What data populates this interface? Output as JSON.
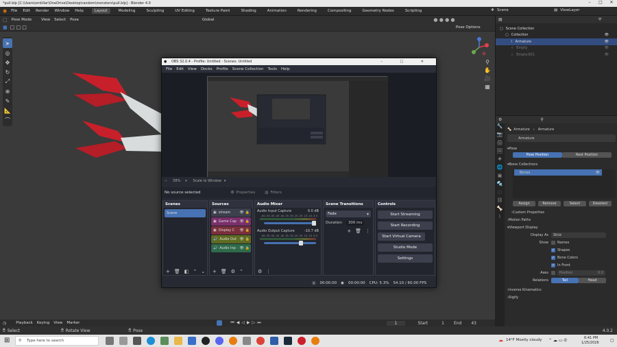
{
  "window": {
    "title": "*pull.blp [C:\\Users\\omtillar\\OneDrive\\Desktop\\random\\monsters\\pull.blp] - Blender 4.0"
  },
  "menu": [
    "File",
    "Edit",
    "Render",
    "Window",
    "Help"
  ],
  "workspaces": [
    "Layout",
    "Modeling",
    "Sculpting",
    "UV Editing",
    "Texture Paint",
    "Shading",
    "Animation",
    "Rendering",
    "Compositing",
    "Geometry Nodes",
    "Scripting"
  ],
  "active_workspace": "Layout",
  "scene_name": "Scene",
  "view_layer": "ViewLayer",
  "viewport_header": {
    "mode": "Pose Mode",
    "menus": [
      "View",
      "Select",
      "Pose"
    ],
    "orientation": "Global",
    "pose_options": "Pose Options"
  },
  "outliner": {
    "items": [
      {
        "label": "Scene Collection",
        "state": "normal"
      },
      {
        "label": "Collection",
        "state": "normal"
      },
      {
        "label": "Armature",
        "state": "selected"
      },
      {
        "label": "Empty",
        "state": "dim"
      },
      {
        "label": "Empty.001",
        "state": "dim"
      }
    ]
  },
  "properties": {
    "breadcrumb": [
      "Armature",
      "Armature"
    ],
    "data_name": "Armature",
    "pose_section": "Pose",
    "pose_position": "Pose Position",
    "rest_position": "Rest Position",
    "bone_collections": "Bone Collections",
    "bones_item": "Bones",
    "assign": "Assign",
    "remove": "Remove",
    "select": "Select",
    "deselect": "Deselect",
    "custom_properties": "Custom Properties",
    "motion_paths": "Motion Paths",
    "viewport_display": "Viewport Display",
    "display_as_label": "Display As",
    "display_as_value": "Stick",
    "show_label": "Show",
    "show_options": [
      {
        "label": "Names",
        "checked": false
      },
      {
        "label": "Shapes",
        "checked": true
      },
      {
        "label": "Bone Colors",
        "checked": true
      },
      {
        "label": "In Front",
        "checked": true
      }
    ],
    "axes_label": "Axes",
    "axes_position": "Position",
    "axes_value": "0.0",
    "relations_label": "Relations",
    "relations_tail": "Tail",
    "relations_head": "Head",
    "inverse_kinematics": "Inverse Kinematics",
    "rigify": "Rigify"
  },
  "timeline": {
    "menus": [
      "Playback",
      "Keying",
      "View",
      "Marker"
    ],
    "current_frame": "1",
    "start_label": "Start",
    "start": "1",
    "end_label": "End",
    "end": "43"
  },
  "statusbar": {
    "select": "Select",
    "rotate": "Rotate View",
    "pose": "Pose",
    "version": "4.0.2"
  },
  "obs": {
    "title": "OBS 32.0.4 - Profile: Untitled - Scenes: Untitled",
    "menu": [
      "File",
      "Edit",
      "View",
      "Docks",
      "Profile",
      "Scene Collection",
      "Tools",
      "Help"
    ],
    "zoom": "58%",
    "scale_mode": "Scale to Window",
    "no_source": "No source selected",
    "properties": "Properties",
    "filters": "Filters",
    "docks": {
      "scenes": "Scenes",
      "sources": "Sources",
      "mixer": "Audio Mixer",
      "transitions": "Scene Transitions",
      "controls": "Controls"
    },
    "scenes": [
      "Scene"
    ],
    "sources": [
      {
        "label": "stream",
        "color": "#3c404d"
      },
      {
        "label": "Game Cap",
        "color": "#7a2f6b"
      },
      {
        "label": "Display C",
        "color": "#7a2f3a"
      },
      {
        "label": "Audio Out",
        "color": "#5e6b22"
      },
      {
        "label": "Audio Inp",
        "color": "#2f6b4a"
      }
    ],
    "mixer": [
      {
        "name": "Audio Input Capture",
        "db": "0.0 dB"
      },
      {
        "name": "Audio Output Capture",
        "db": "-10.7 dB"
      }
    ],
    "meter_scale": "-60 -55 -50 -45 -40 -35 -30 -25 -20 -15 -10 -5 0",
    "transition": "Fade",
    "duration_label": "Duration",
    "duration": "300 ms",
    "controls": [
      "Start Streaming",
      "Start Recording",
      "Start Virtual Camera",
      "Studio Mode",
      "Settings"
    ],
    "status": {
      "stream_time": "00:00:00",
      "rec_time": "00:00:00",
      "cpu": "CPU: 5.3%",
      "fps": "54.10 / 60.00 FPS"
    }
  },
  "taskbar": {
    "search_placeholder": "Type here to search",
    "weather": "14°F  Mostly cloudy",
    "time": "6:41 PM",
    "date": "1/25/2026"
  },
  "colors": {
    "accent": "#4772b3",
    "selected": "#334d80",
    "bones_red": "#c8202a",
    "bones_white": "#d8dcdc"
  }
}
